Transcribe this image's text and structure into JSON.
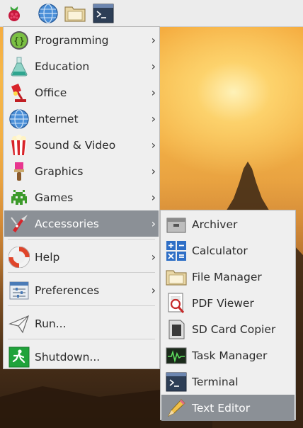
{
  "menu": {
    "items": [
      {
        "label": "Programming",
        "icon": "programming-icon"
      },
      {
        "label": "Education",
        "icon": "education-flask-icon"
      },
      {
        "label": "Office",
        "icon": "office-lamp-icon"
      },
      {
        "label": "Internet",
        "icon": "globe-icon"
      },
      {
        "label": "Sound & Video",
        "icon": "popcorn-icon"
      },
      {
        "label": "Graphics",
        "icon": "paintbrush-icon"
      },
      {
        "label": "Games",
        "icon": "space-invader-icon"
      },
      {
        "label": "Accessories",
        "icon": "pocket-knife-icon"
      },
      {
        "label": "Help",
        "icon": "lifebuoy-icon"
      },
      {
        "label": "Preferences",
        "icon": "preferences-sliders-icon"
      },
      {
        "label": "Run...",
        "icon": "paper-plane-icon"
      },
      {
        "label": "Shutdown...",
        "icon": "exit-running-man-icon"
      }
    ],
    "arrow_glyph": "›",
    "selected": "Accessories"
  },
  "submenu": {
    "items": [
      {
        "label": "Archiver",
        "icon": "archiver-icon"
      },
      {
        "label": "Calculator",
        "icon": "calculator-icon"
      },
      {
        "label": "File Manager",
        "icon": "folder-icon"
      },
      {
        "label": "PDF Viewer",
        "icon": "pdf-viewer-icon"
      },
      {
        "label": "SD Card Copier",
        "icon": "sd-card-icon"
      },
      {
        "label": "Task Manager",
        "icon": "task-manager-icon"
      },
      {
        "label": "Terminal",
        "icon": "terminal-icon"
      },
      {
        "label": "Text Editor",
        "icon": "text-editor-pencil-icon"
      }
    ],
    "selected": "Text Editor"
  },
  "panel": {
    "launchers": [
      "raspberry-menu-icon",
      "web-browser-globe-icon",
      "file-manager-folder-icon",
      "terminal-icon"
    ]
  },
  "colors": {
    "highlight": "#8b9096",
    "menu_bg": "#efefef",
    "panel_bg": "#ececec"
  }
}
